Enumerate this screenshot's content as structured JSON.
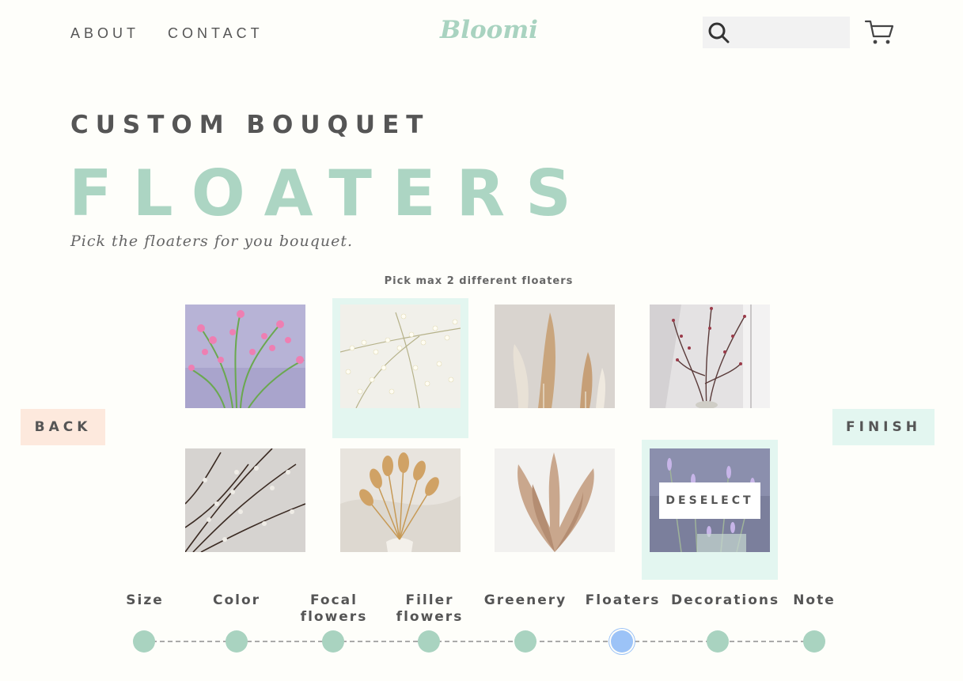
{
  "nav": {
    "about": "ABOUT",
    "contact": "CONTACT",
    "logo": "Bloomi"
  },
  "search": {
    "placeholder": ""
  },
  "page": {
    "eyebrow": "CUSTOM BOUQUET",
    "title": "FLOATERS",
    "subtitle": "Pick the floaters for you bouquet.",
    "hint": "Pick max 2 different floaters"
  },
  "floaters": [
    {
      "name": "pink-wildflowers",
      "selected": false
    },
    {
      "name": "babys-breath",
      "selected": true
    },
    {
      "name": "pampas-grass",
      "selected": false
    },
    {
      "name": "berry-branches",
      "selected": false
    },
    {
      "name": "pussy-willow",
      "selected": false
    },
    {
      "name": "bunny-tails",
      "selected": false
    },
    {
      "name": "dried-reeds",
      "selected": false
    },
    {
      "name": "lavender",
      "selected": true
    }
  ],
  "deselect_label": "DESELECT",
  "buttons": {
    "back": "BACK",
    "finish": "FINISH"
  },
  "steps": {
    "items": [
      {
        "line1": "",
        "line2": "Size"
      },
      {
        "line1": "",
        "line2": "Color"
      },
      {
        "line1": "Focal",
        "line2": "flowers"
      },
      {
        "line1": "Filler",
        "line2": "flowers"
      },
      {
        "line1": "",
        "line2": "Greenery"
      },
      {
        "line1": "",
        "line2": "Floaters"
      },
      {
        "line1": "",
        "line2": "Decorations"
      },
      {
        "line1": "",
        "line2": "Note"
      }
    ],
    "active_index": 5
  },
  "colors": {
    "accent": "#acd5c3",
    "selected_bg": "#e3f6f0",
    "back_bg": "#fde9dd",
    "active_step": "#9cc3f7"
  }
}
